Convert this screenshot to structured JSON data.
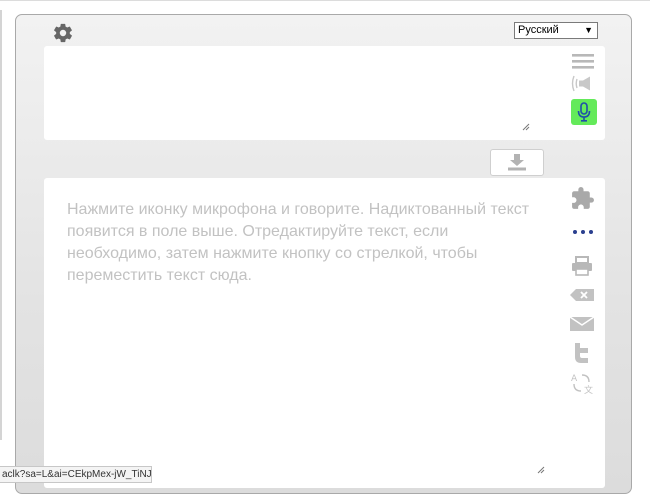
{
  "language": {
    "selected": "Русский"
  },
  "dictation": {
    "placeholder": "Нажмите иконку микрофона и говорите. Надиктованный текст появится в поле выше. Отредактируйте текст, если необходимо, затем нажмите кнопку со стрелкой, чтобы переместить текст сюда."
  },
  "status_bar": {
    "url": "aclk?sa=L&ai=CEkpMex-jW_TiNJ..."
  },
  "colors": {
    "mic_active": "#64ea5a",
    "icon_gray": "#b8b8b8",
    "more_dots": "#2a3f8f"
  },
  "icons": [
    "gear-icon",
    "menu-icon",
    "speaker-icon",
    "microphone-icon",
    "download-arrow-icon",
    "puzzle-icon",
    "more-icon",
    "print-icon",
    "clear-icon",
    "email-icon",
    "twitter-icon",
    "translate-icon"
  ]
}
